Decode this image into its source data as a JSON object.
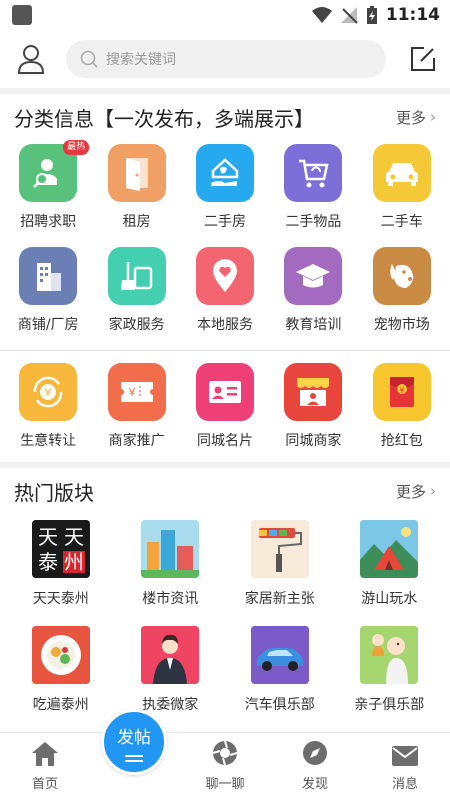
{
  "status": {
    "time": "11:14"
  },
  "search": {
    "placeholder": "搜索关键词"
  },
  "categories": {
    "title": "分类信息【一次发布，多端展示】",
    "more": "更多",
    "badge": "最热",
    "items": [
      {
        "label": "招聘求职",
        "color": "#58c27d",
        "icon": "person-search-icon"
      },
      {
        "label": "租房",
        "color": "#f0a064",
        "icon": "door-icon"
      },
      {
        "label": "二手房",
        "color": "#27a9f0",
        "icon": "house-hand-icon"
      },
      {
        "label": "二手物品",
        "color": "#7e6ed8",
        "icon": "cart-recycle-icon"
      },
      {
        "label": "二手车",
        "color": "#f4c837",
        "icon": "car-icon"
      },
      {
        "label": "商铺/厂房",
        "color": "#6b7fb5",
        "icon": "building-icon"
      },
      {
        "label": "家政服务",
        "color": "#43cfb0",
        "icon": "broom-icon"
      },
      {
        "label": "本地服务",
        "color": "#f36570",
        "icon": "location-heart-icon"
      },
      {
        "label": "教育培训",
        "color": "#a36bc0",
        "icon": "graduation-cap-icon"
      },
      {
        "label": "宠物市场",
        "color": "#c98b43",
        "icon": "dog-icon"
      },
      {
        "label": "生意转让",
        "color": "#f7b73b",
        "icon": "yuan-exchange-icon"
      },
      {
        "label": "商家推广",
        "color": "#f26d4a",
        "icon": "ticket-icon"
      },
      {
        "label": "同城名片",
        "color": "#ef3f77",
        "icon": "card-icon"
      },
      {
        "label": "同城商家",
        "color": "#e8453c",
        "icon": "shop-icon"
      },
      {
        "label": "抢红包",
        "color": "#f7c62f",
        "icon": "red-packet-icon"
      }
    ]
  },
  "hot": {
    "title": "热门版块",
    "more": "更多",
    "items": [
      {
        "label": "天天泰州",
        "icon": "tiantian-taizhou-logo"
      },
      {
        "label": "楼市资讯",
        "icon": "buildings-image"
      },
      {
        "label": "家居新主张",
        "icon": "paint-roller-image"
      },
      {
        "label": "游山玩水",
        "icon": "tent-image"
      },
      {
        "label": "吃遍泰州",
        "icon": "food-plate-image"
      },
      {
        "label": "执委微家",
        "icon": "businesswoman-image"
      },
      {
        "label": "汽车俱乐部",
        "icon": "sports-car-image"
      },
      {
        "label": "亲子俱乐部",
        "icon": "parent-child-image"
      }
    ],
    "logo_text": [
      "天",
      "天",
      "泰",
      "州"
    ]
  },
  "nav": {
    "home": "首页",
    "post": "发帖",
    "chat": "聊一聊",
    "discover": "发现",
    "messages": "消息"
  }
}
